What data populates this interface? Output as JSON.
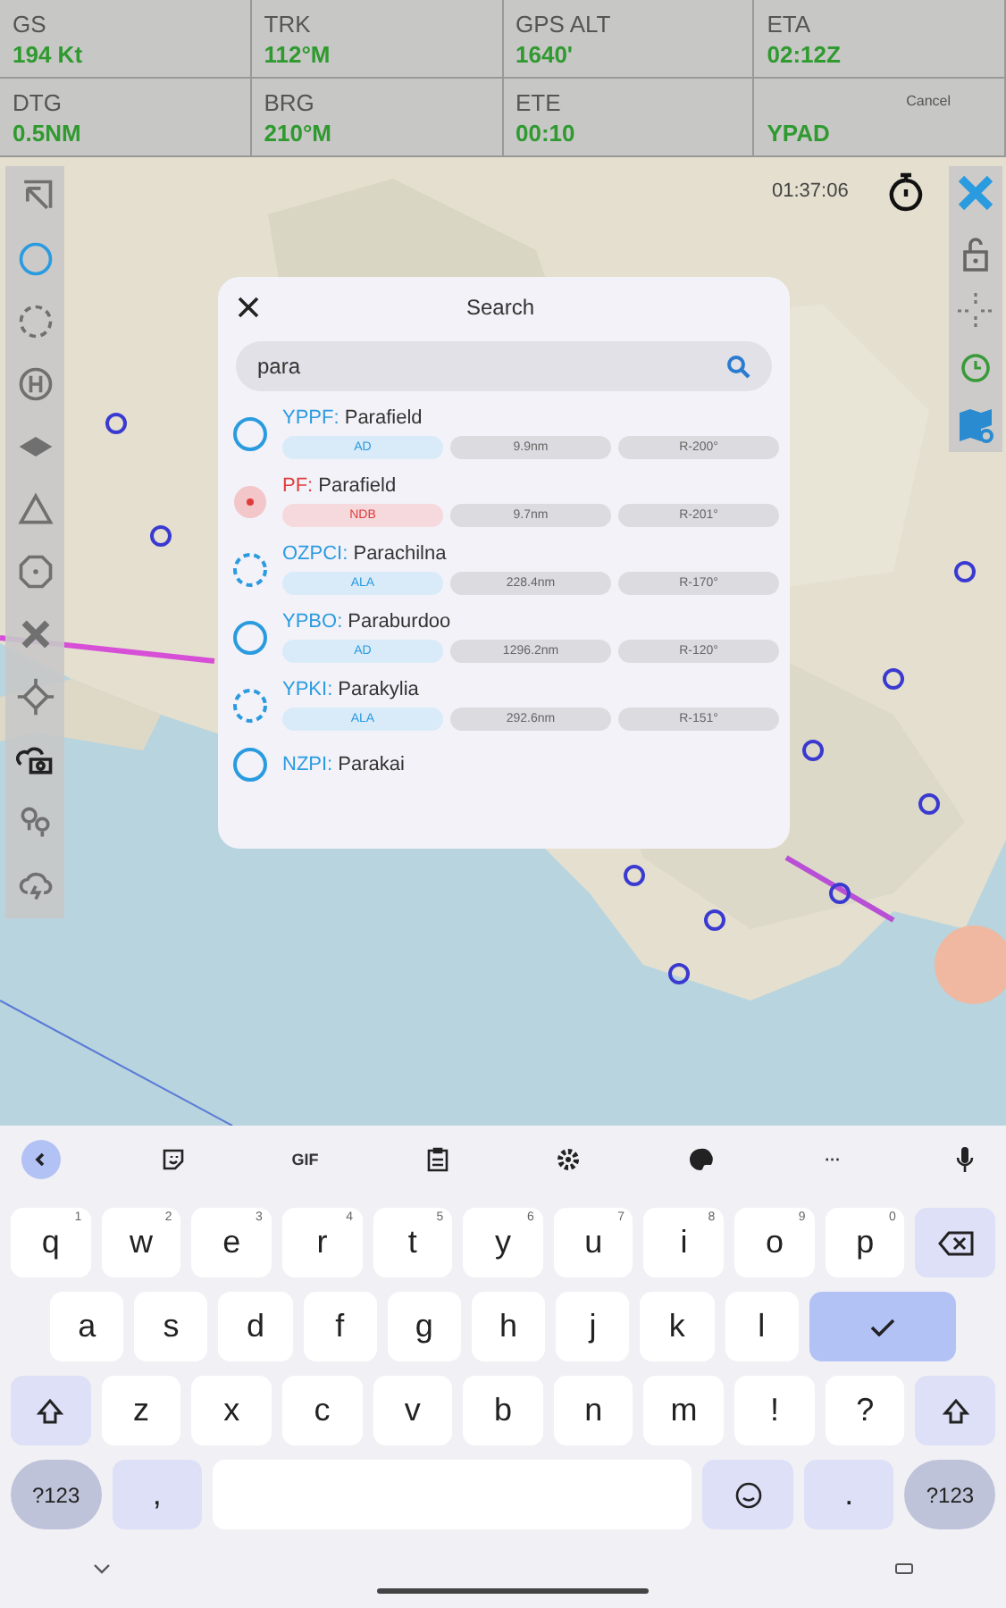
{
  "info_panel": [
    {
      "label": "GS",
      "value": "194 Kt"
    },
    {
      "label": "TRK",
      "value": "112°M"
    },
    {
      "label": "GPS ALT",
      "value": "1640'"
    },
    {
      "label": "ETA",
      "value": "02:12Z"
    },
    {
      "label": "DTG",
      "value": "0.5NM"
    },
    {
      "label": "BRG",
      "value": "210°M"
    },
    {
      "label": "ETE",
      "value": "00:10"
    },
    {
      "label": "Cancel",
      "value": "YPAD"
    }
  ],
  "timer": {
    "time": "01:37:06"
  },
  "left_toolbar": [
    {
      "selected": false
    },
    {
      "selected": true
    },
    {
      "selected": false
    },
    {
      "selected": false
    },
    {
      "selected": false
    },
    {
      "selected": false
    },
    {
      "selected": false
    },
    {
      "selected": false
    },
    {
      "selected": false
    },
    {
      "selected": false
    },
    {
      "selected": false
    },
    {
      "selected": false
    }
  ],
  "search_dialog": {
    "title": "Search",
    "query": "para",
    "results": [
      {
        "kind": "ad",
        "code": "YPPF:",
        "name": " Parafield",
        "type": "AD",
        "distance": "9.9nm",
        "bearing": "R-200°"
      },
      {
        "kind": "ndb",
        "code": "PF:",
        "name": " Parafield",
        "type": "NDB",
        "distance": "9.7nm",
        "bearing": "R-201°"
      },
      {
        "kind": "ala",
        "code": "OZPCI:",
        "name": " Parachilna",
        "type": "ALA",
        "distance": "228.4nm",
        "bearing": "R-170°"
      },
      {
        "kind": "ad",
        "code": "YPBO:",
        "name": " Paraburdoo",
        "type": "AD",
        "distance": "1296.2nm",
        "bearing": "R-120°"
      },
      {
        "kind": "ala",
        "code": "YPKI:",
        "name": " Parakylia",
        "type": "ALA",
        "distance": "292.6nm",
        "bearing": "R-151°"
      },
      {
        "kind": "ad",
        "code": "NZPI:",
        "name": " Parakai"
      }
    ]
  },
  "keyboard": {
    "toolbar": [
      {
        "kind": "back"
      },
      {
        "kind": "sticker"
      },
      {
        "kind": "gif",
        "label": "GIF"
      },
      {
        "kind": "clipboard"
      },
      {
        "kind": "settings"
      },
      {
        "kind": "palette"
      },
      {
        "kind": "more",
        "label": "···"
      },
      {
        "kind": "mic"
      }
    ],
    "rows": [
      [
        {
          "kind": "letter",
          "label": "q",
          "hint": "1"
        },
        {
          "kind": "letter",
          "label": "w",
          "hint": "2"
        },
        {
          "kind": "letter",
          "label": "e",
          "hint": "3"
        },
        {
          "kind": "letter",
          "label": "r",
          "hint": "4"
        },
        {
          "kind": "letter",
          "label": "t",
          "hint": "5"
        },
        {
          "kind": "letter",
          "label": "y",
          "hint": "6"
        },
        {
          "kind": "letter",
          "label": "u",
          "hint": "7"
        },
        {
          "kind": "letter",
          "label": "i",
          "hint": "8"
        },
        {
          "kind": "letter",
          "label": "o",
          "hint": "9"
        },
        {
          "kind": "letter",
          "label": "p",
          "hint": "0"
        },
        {
          "kind": "backspace"
        }
      ],
      [
        {
          "kind": "letter",
          "label": "a"
        },
        {
          "kind": "letter",
          "label": "s"
        },
        {
          "kind": "letter",
          "label": "d"
        },
        {
          "kind": "letter",
          "label": "f"
        },
        {
          "kind": "letter",
          "label": "g"
        },
        {
          "kind": "letter",
          "label": "h"
        },
        {
          "kind": "letter",
          "label": "j"
        },
        {
          "kind": "letter",
          "label": "k"
        },
        {
          "kind": "letter",
          "label": "l"
        },
        {
          "kind": "enter"
        }
      ],
      [
        {
          "kind": "shift"
        },
        {
          "kind": "letter",
          "label": "z"
        },
        {
          "kind": "letter",
          "label": "x"
        },
        {
          "kind": "letter",
          "label": "c"
        },
        {
          "kind": "letter",
          "label": "v"
        },
        {
          "kind": "letter",
          "label": "b"
        },
        {
          "kind": "letter",
          "label": "n"
        },
        {
          "kind": "letter",
          "label": "m"
        },
        {
          "kind": "letter",
          "label": "!"
        },
        {
          "kind": "letter",
          "label": "?"
        },
        {
          "kind": "shift"
        }
      ],
      [
        {
          "kind": "round",
          "label": "?123"
        },
        {
          "kind": "action",
          "label": ","
        },
        {
          "kind": "space"
        },
        {
          "kind": "emoji"
        },
        {
          "kind": "action",
          "label": "."
        },
        {
          "kind": "round",
          "label": "?123"
        }
      ]
    ]
  }
}
